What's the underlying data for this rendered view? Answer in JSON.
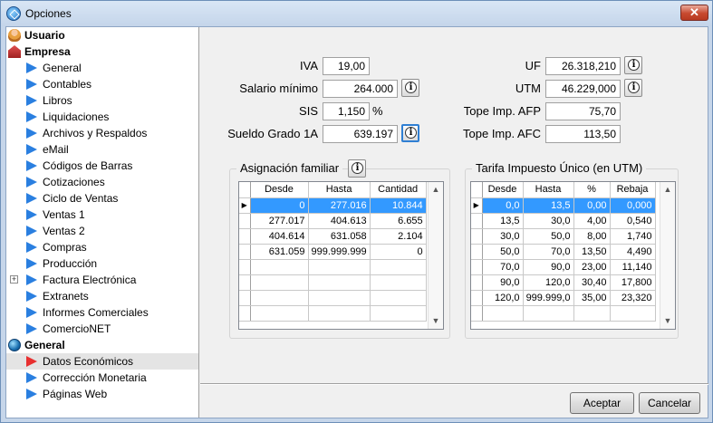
{
  "window": {
    "title": "Opciones",
    "close_label": "✕"
  },
  "tree": {
    "groups": [
      {
        "label": "Usuario",
        "items": []
      },
      {
        "label": "Empresa",
        "items": [
          "General",
          "Contables",
          "Libros",
          "Liquidaciones",
          "Archivos y Respaldos",
          "eMail",
          "Códigos de Barras",
          "Cotizaciones",
          "Ciclo de Ventas",
          "Ventas 1",
          "Ventas 2",
          "Compras",
          "Producción",
          "Factura Electrónica",
          "Extranets",
          "Informes Comerciales",
          "ComercioNET"
        ]
      },
      {
        "label": "General",
        "items": [
          "Datos Económicos",
          "Corrección Monetaria",
          "Páginas Web"
        ]
      }
    ],
    "selected": "Datos Económicos",
    "expandable": "Factura Electrónica"
  },
  "fields": {
    "iva": {
      "label": "IVA",
      "value": "19,00"
    },
    "salario": {
      "label": "Salario mínimo",
      "value": "264.000"
    },
    "sis": {
      "label": "SIS",
      "value": "1,150",
      "unit": "%"
    },
    "sueldo": {
      "label": "Sueldo Grado 1A",
      "value": "639.197"
    },
    "uf": {
      "label": "UF",
      "value": "26.318,210"
    },
    "utm": {
      "label": "UTM",
      "value": "46.229,000"
    },
    "afp": {
      "label": "Tope Imp. AFP",
      "value": "75,70"
    },
    "afc": {
      "label": "Tope Imp. AFC",
      "value": "113,50"
    }
  },
  "asignacion": {
    "title": "Asignación familiar",
    "columns": [
      "Desde",
      "Hasta",
      "Cantidad"
    ],
    "rows": [
      [
        "0",
        "277.016",
        "10.844"
      ],
      [
        "277.017",
        "404.613",
        "6.655"
      ],
      [
        "404.614",
        "631.058",
        "2.104"
      ],
      [
        "631.059",
        "999.999.999",
        "0"
      ],
      [
        "",
        "",
        ""
      ],
      [
        "",
        "",
        ""
      ],
      [
        "",
        "",
        ""
      ],
      [
        "",
        "",
        ""
      ]
    ]
  },
  "tarifa": {
    "title": "Tarifa Impuesto Único (en UTM)",
    "columns": [
      "Desde",
      "Hasta",
      "%",
      "Rebaja"
    ],
    "rows": [
      [
        "0,0",
        "13,5",
        "0,00",
        "0,000"
      ],
      [
        "13,5",
        "30,0",
        "4,00",
        "0,540"
      ],
      [
        "30,0",
        "50,0",
        "8,00",
        "1,740"
      ],
      [
        "50,0",
        "70,0",
        "13,50",
        "4,490"
      ],
      [
        "70,0",
        "90,0",
        "23,00",
        "11,140"
      ],
      [
        "90,0",
        "120,0",
        "30,40",
        "17,800"
      ],
      [
        "120,0",
        "999.999,0",
        "35,00",
        "23,320"
      ],
      [
        "",
        "",
        "",
        ""
      ]
    ]
  },
  "buttons": {
    "accept": "Aceptar",
    "cancel": "Cancelar"
  },
  "icons": {
    "info": "i",
    "row_indicator": "▶",
    "scroll_up": "▲",
    "scroll_down": "▼",
    "expand": "+"
  }
}
